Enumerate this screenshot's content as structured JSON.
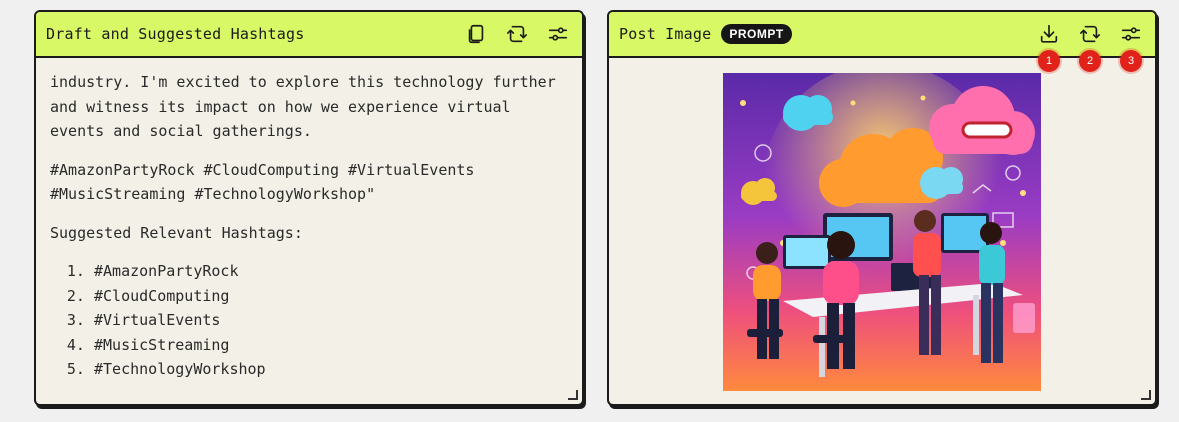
{
  "left_panel": {
    "title": "Draft and Suggested Hashtags",
    "paragraph1": "industry. I'm excited to explore this technology further and witness its impact on how we experience virtual events and social gatherings.",
    "paragraph2": "#AmazonPartyRock #CloudComputing #VirtualEvents #MusicStreaming #TechnologyWorkshop\"",
    "subheading": "Suggested Relevant Hashtags:",
    "hashtags": [
      "#AmazonPartyRock",
      "#CloudComputing",
      "#VirtualEvents",
      "#MusicStreaming",
      "#TechnologyWorkshop"
    ],
    "icons": [
      "copy-icon",
      "refresh-icon",
      "settings-sliders-icon"
    ]
  },
  "right_panel": {
    "title": "Post Image",
    "badge": "PROMPT",
    "icons": [
      "download-icon",
      "refresh-icon",
      "settings-sliders-icon"
    ],
    "markers": [
      "1",
      "2",
      "3"
    ]
  },
  "colors": {
    "header_bg": "#d8f965",
    "panel_bg": "#f3f1e7",
    "border": "#1b1b1b",
    "marker": "#e0221a"
  }
}
